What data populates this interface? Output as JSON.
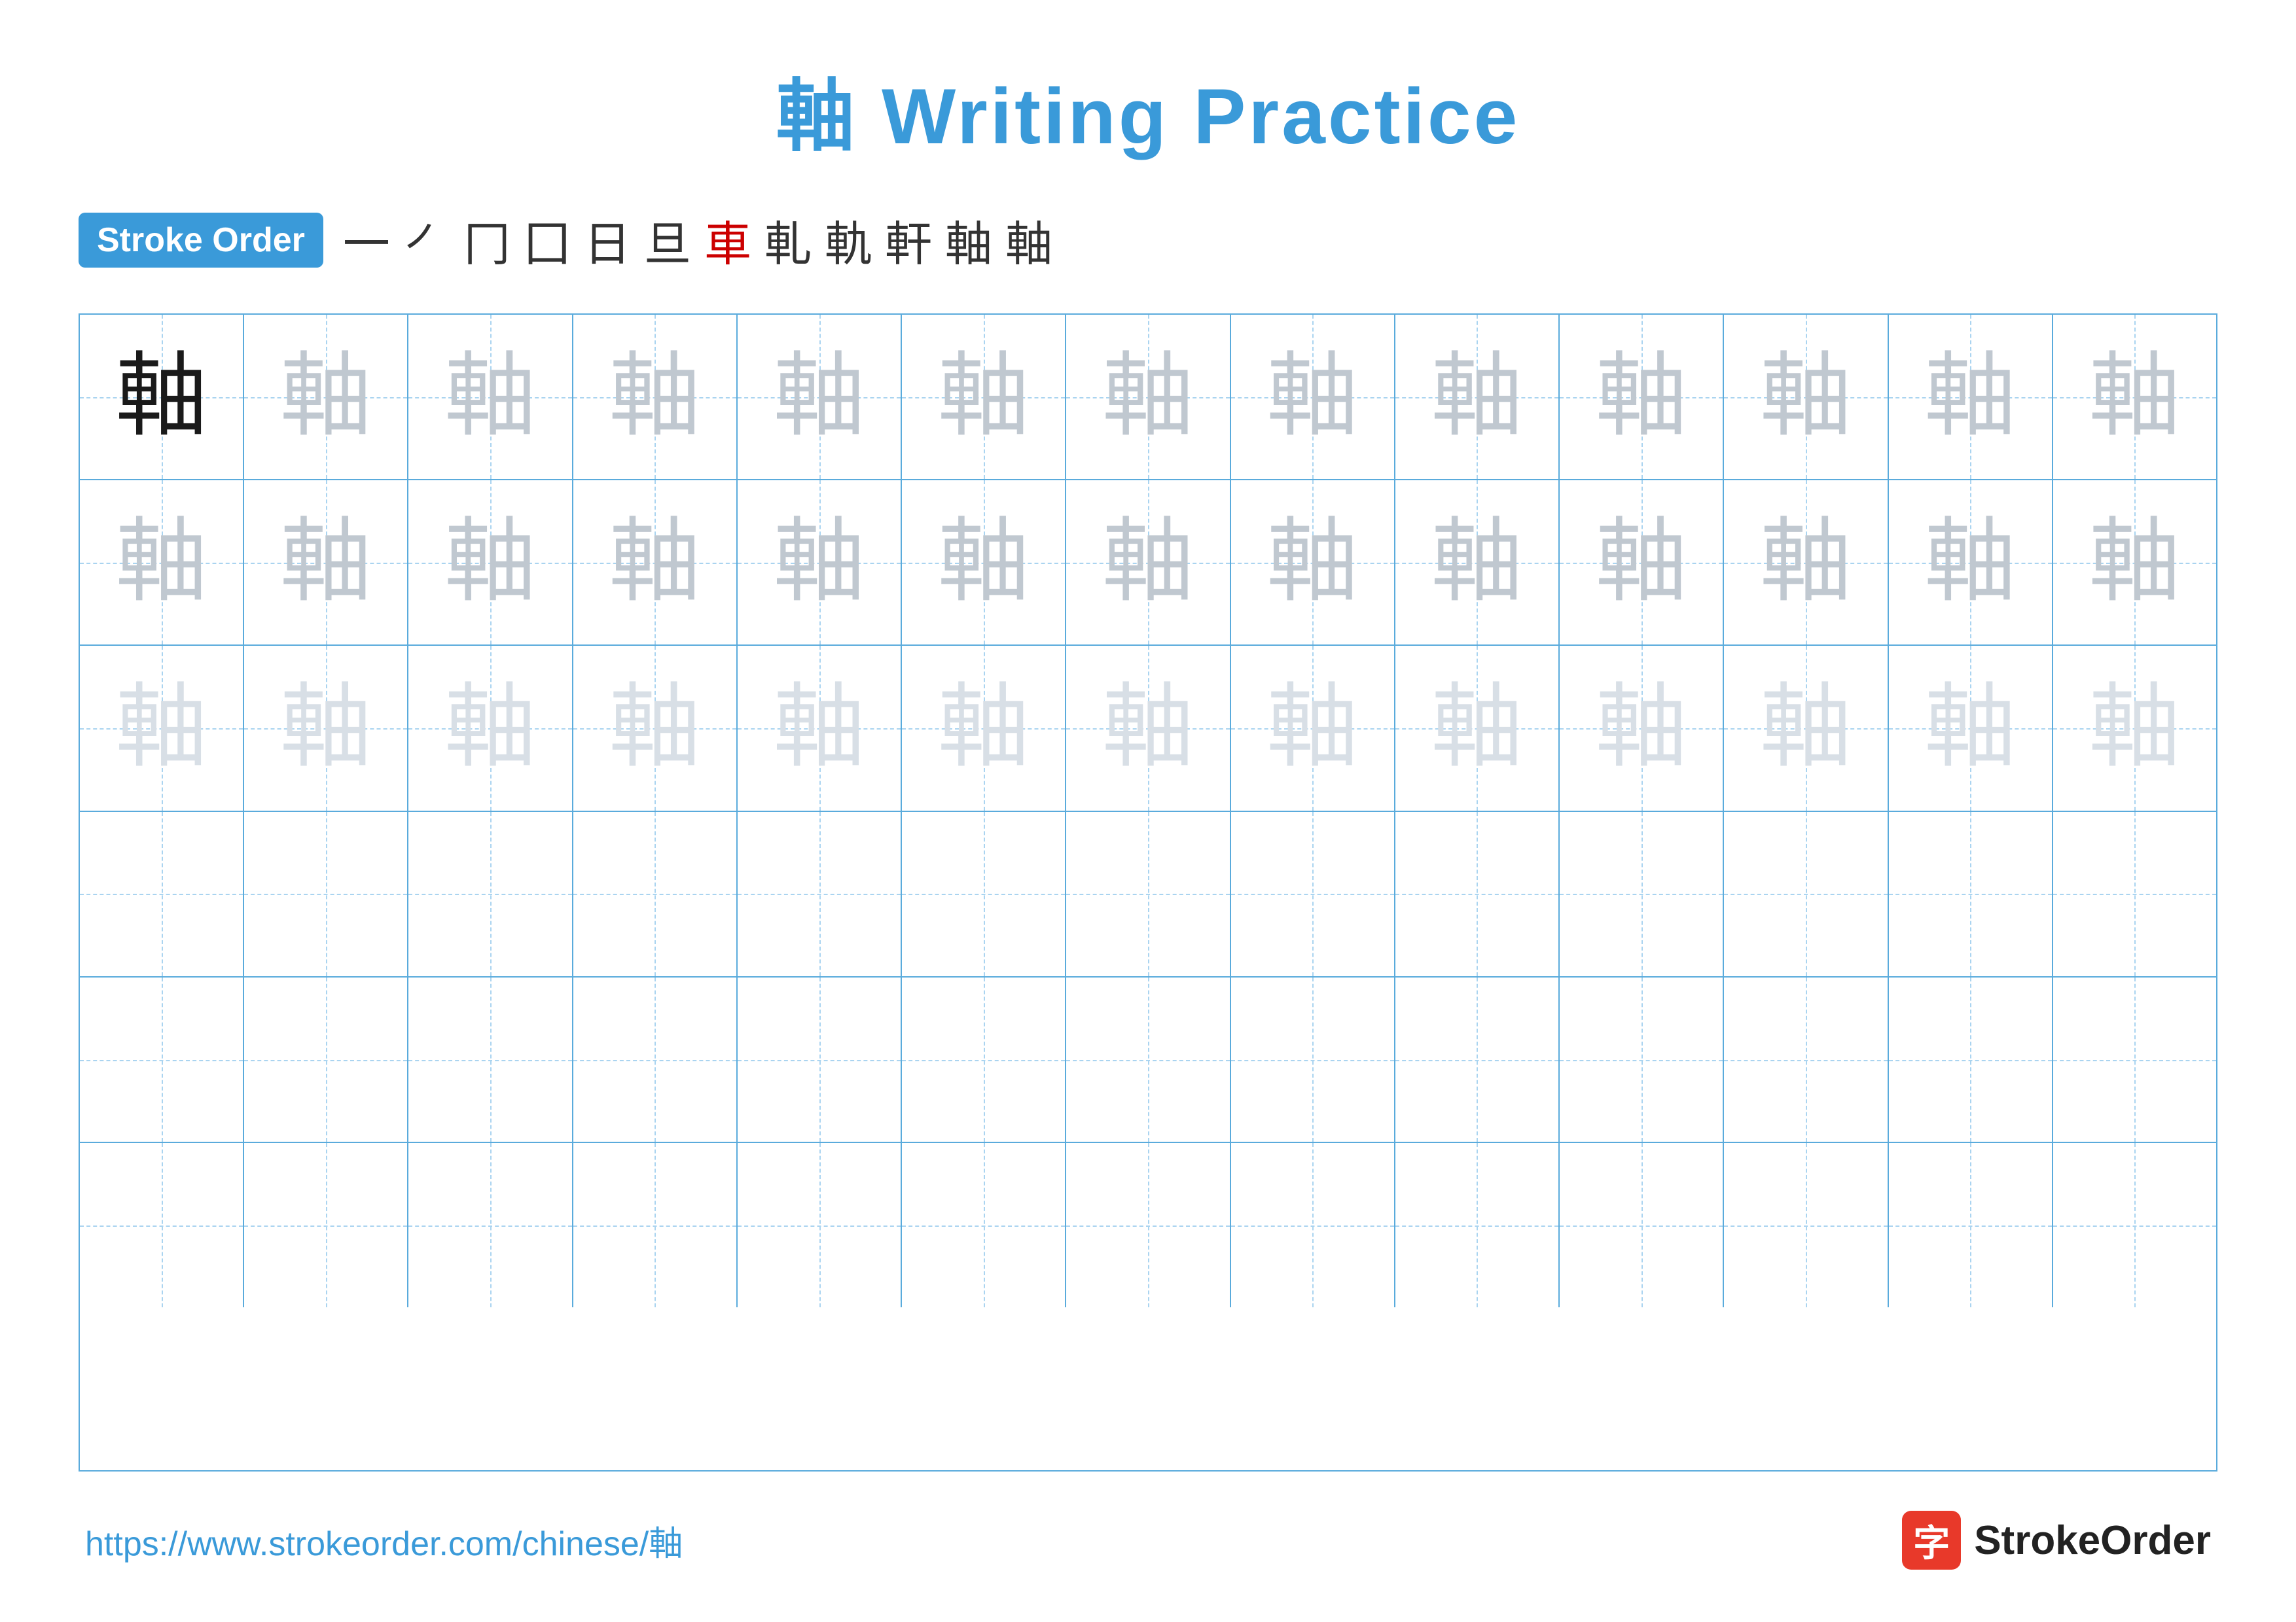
{
  "title": {
    "char": "軸",
    "text": " Writing Practice"
  },
  "stroke_order": {
    "badge_label": "Stroke Order",
    "strokes": [
      "一",
      "㇒",
      "冂",
      "冂",
      "日",
      "旦",
      "車",
      "軋",
      "軌",
      "軒",
      "軸",
      "軸"
    ]
  },
  "grid": {
    "rows": 6,
    "cols": 13,
    "character": "軸",
    "row_styles": [
      "dark",
      "medium",
      "light",
      "empty",
      "empty",
      "empty"
    ]
  },
  "footer": {
    "url": "https://www.strokeorder.com/chinese/軸",
    "logo_char": "字",
    "logo_text": "StrokeOrder"
  }
}
